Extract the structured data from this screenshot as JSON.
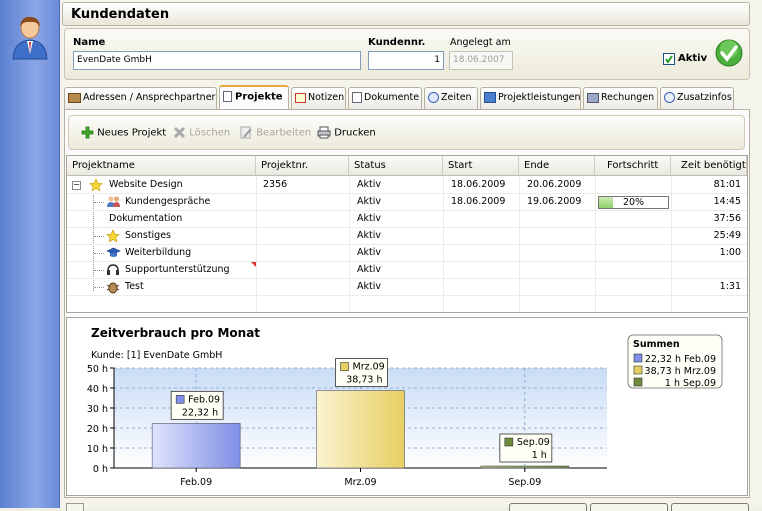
{
  "window": {
    "title": "Kundendaten"
  },
  "customer": {
    "name_label": "Name",
    "name_value": "EvenDate GmbH",
    "number_label": "Kundennr.",
    "number_value": "1",
    "created_label": "Angelegt am",
    "created_value": "18.06.2007",
    "active_label": "Aktiv",
    "active_checked": true
  },
  "tabs": [
    {
      "label": "Adressen / Ansprechpartner",
      "icon": "address-icon"
    },
    {
      "label": "Projekte",
      "icon": "document-icon",
      "active": true
    },
    {
      "label": "Notizen",
      "icon": "note-icon"
    },
    {
      "label": "Dokumente",
      "icon": "documents-icon"
    },
    {
      "label": "Zeiten",
      "icon": "clock-icon"
    },
    {
      "label": "Projektleistungen",
      "icon": "services-icon"
    },
    {
      "label": "Rechungen",
      "icon": "invoice-icon"
    },
    {
      "label": "Zusatzinfos",
      "icon": "info-icon"
    }
  ],
  "toolbar": {
    "new_project": "Neues Projekt",
    "delete": "Löschen",
    "edit": "Bearbeiten",
    "print": "Drucken"
  },
  "grid": {
    "columns": [
      "Projektname",
      "Projektnr.",
      "Status",
      "Start",
      "Ende",
      "Fortschritt",
      "Zeit benötigt"
    ],
    "rows": [
      {
        "name": "Website Design",
        "nr": "2356",
        "status": "Aktiv",
        "start": "18.06.2009",
        "end": "20.06.2009",
        "progress": "",
        "time": "81:01",
        "icon": "star-icon",
        "level": 0
      },
      {
        "name": "Kundengespräche",
        "nr": "",
        "status": "Aktiv",
        "start": "18.06.2009",
        "end": "19.06.2009",
        "progress": "20%",
        "progress_value": 0.2,
        "time": "14:45",
        "icon": "people-icon",
        "level": 1
      },
      {
        "name": "Dokumentation",
        "nr": "",
        "status": "Aktiv",
        "start": "",
        "end": "",
        "progress": "",
        "time": "37:56",
        "icon": "",
        "level": 1
      },
      {
        "name": "Sonstiges",
        "nr": "",
        "status": "Aktiv",
        "start": "",
        "end": "",
        "progress": "",
        "time": "25:49",
        "icon": "star-icon",
        "level": 1
      },
      {
        "name": "Weiterbildung",
        "nr": "",
        "status": "Aktiv",
        "start": "",
        "end": "",
        "progress": "",
        "time": "1:00",
        "icon": "graduation-icon",
        "level": 1
      },
      {
        "name": "Supportunterstützung",
        "nr": "",
        "status": "Aktiv",
        "start": "",
        "end": "",
        "progress": "",
        "time": "",
        "icon": "headset-icon",
        "level": 1
      },
      {
        "name": "Test",
        "nr": "",
        "status": "Aktiv",
        "start": "",
        "end": "",
        "progress": "",
        "time": "1:31",
        "icon": "bug-icon",
        "level": 1
      }
    ]
  },
  "chart_data": {
    "type": "bar",
    "title": "Zeitverbrauch pro Monat",
    "subtitle": "Kunde: [1] EvenDate GmbH",
    "categories": [
      "Feb.09",
      "Mrz.09",
      "Sep.09"
    ],
    "values": [
      22.32,
      38.73,
      1
    ],
    "value_labels": [
      "22,32 h",
      "38,73 h",
      "1 h"
    ],
    "ylim": [
      0,
      50
    ],
    "yticks": [
      "0 h",
      "10 h",
      "20 h",
      "30 h",
      "40 h",
      "50 h"
    ],
    "colors": [
      "#7f8fe6",
      "#e7cf62",
      "#6e8a3a"
    ],
    "legend": {
      "title": "Summen",
      "entries": [
        "22,32 h Feb.09",
        "38,73 h Mrz.09",
        "1 h Sep.09"
      ],
      "placement": "top-right"
    },
    "grid": true
  }
}
